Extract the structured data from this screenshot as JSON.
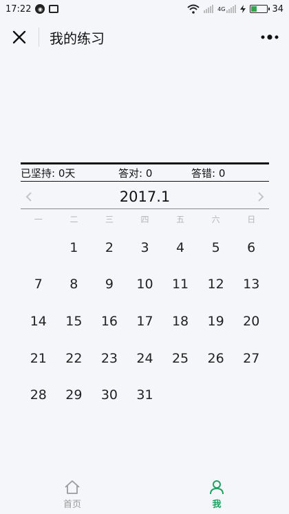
{
  "status_bar": {
    "time": "17:22",
    "network_label": "4G",
    "battery_percent": "34",
    "battery_level": 0.34
  },
  "nav": {
    "title": "我的练习"
  },
  "stats": {
    "streak": "已坚持: 0天",
    "correct": "答对: 0",
    "wrong": "答错: 0"
  },
  "calendar": {
    "month_label": "2017.1",
    "weekdays": [
      "一",
      "二",
      "三",
      "四",
      "五",
      "六",
      "日"
    ],
    "leading_blanks": 1,
    "days": [
      "1",
      "2",
      "3",
      "4",
      "5",
      "6",
      "7",
      "8",
      "9",
      "10",
      "11",
      "12",
      "13",
      "14",
      "15",
      "16",
      "17",
      "18",
      "19",
      "20",
      "21",
      "22",
      "23",
      "24",
      "25",
      "26",
      "27",
      "28",
      "29",
      "30",
      "31"
    ]
  },
  "tabs": [
    {
      "label": "首页",
      "icon": "home-icon",
      "active": false
    },
    {
      "label": "我",
      "icon": "user-icon",
      "active": true
    }
  ],
  "colors": {
    "accent": "#1aa260",
    "inactive": "#9a9a9a",
    "background": "#f5f6fa"
  }
}
